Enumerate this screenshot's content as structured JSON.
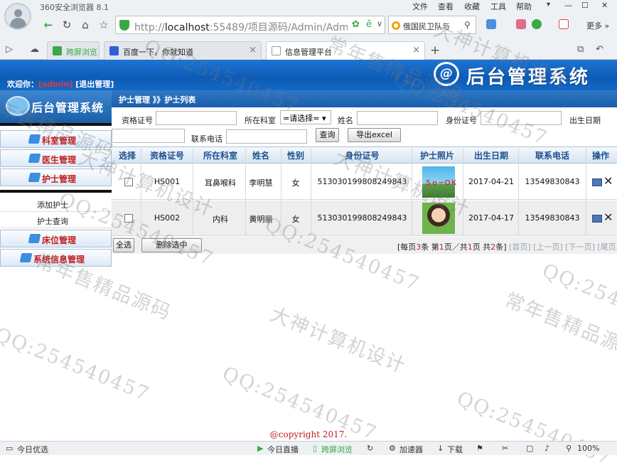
{
  "browser": {
    "title": "360安全浏览器 8.1",
    "menu": [
      "文件",
      "查看",
      "收藏",
      "工具",
      "帮助"
    ],
    "address_prefix": "http://",
    "address_host": "localhost",
    "address_rest": ":55489/项目源码/Admin/Admir",
    "search_text": "俄国民卫队与",
    "more_label": "更多",
    "tabs": [
      {
        "label": "跨屏浏览"
      },
      {
        "label": "百度一下，你就知道"
      },
      {
        "label": "信息管理平台"
      }
    ]
  },
  "header": {
    "welcome_prefix": "欢迎你：",
    "user": "[admin]",
    "logout": "[退出管理]",
    "title": "后台管理系统",
    "logo_glyph": "@"
  },
  "sidebar": {
    "title": "后台管理系统",
    "items": [
      {
        "label": "科室管理",
        "icon": "pen-icon"
      },
      {
        "label": "医生管理",
        "icon": "pen-icon"
      },
      {
        "label": "护士管理",
        "icon": "pen-icon"
      }
    ],
    "subitems": [
      {
        "label": "添加护士"
      },
      {
        "label": "护士查询"
      }
    ],
    "items2": [
      {
        "label": "床位管理",
        "icon": "pen-icon"
      },
      {
        "label": "系统信息管理",
        "icon": "pen-icon"
      }
    ]
  },
  "breadcrumb": "护士管理 》》护士列表",
  "filters": {
    "cert_label": "资格证号",
    "dept_label": "所在科室",
    "dept_value": "=请选择=",
    "name_label": "姓名",
    "id_label": "身份证号",
    "birth_label": "出生日期",
    "phone_label": "联系电话",
    "query_button": "查询",
    "export_button": "导出excel"
  },
  "table": {
    "headers": [
      "选择",
      "资格证号",
      "所在科室",
      "姓名",
      "性别",
      "身份证号",
      "护士照片",
      "出生日期",
      "联系电话",
      "操作"
    ],
    "rows": [
      {
        "cert": "HS001",
        "dept": "耳鼻喉科",
        "name": "李明慧",
        "gender": "女",
        "id": "513030199808249843",
        "photo_text": "Ｓｏ－ＯＫ",
        "birth": "2017-04-21",
        "phone": "13549830843"
      },
      {
        "cert": "HS002",
        "dept": "内科",
        "name": "黄明丽",
        "gender": "女",
        "id": "513030199808249843",
        "photo_text": "",
        "birth": "2017-04-17",
        "phone": "13549830843"
      }
    ]
  },
  "footer": {
    "select_all": "全选",
    "delete_selected": "删除选中",
    "pager_1": "[每页",
    "per_page": "3",
    "pager_2": "条 第",
    "page": "1",
    "pager_3": "页／共",
    "total_pages": "1",
    "pager_4": "页 共",
    "total": "2",
    "pager_5": "条]",
    "first": "[首页]",
    "prev": "[上一页]",
    "next": "[下一页]",
    "last": "[尾页]"
  },
  "copyright": "@copyright 2017.",
  "status": {
    "left": "今日优选",
    "items": [
      "今日直播",
      "跨屏浏览",
      "加速器",
      "下载"
    ],
    "zoom": "100%"
  },
  "watermarks": [
    "常年售精品源码",
    "QQ:254540457",
    "大神计算机设计"
  ],
  "colors": {
    "accent": "#1566c4",
    "danger": "#c31d1d"
  }
}
